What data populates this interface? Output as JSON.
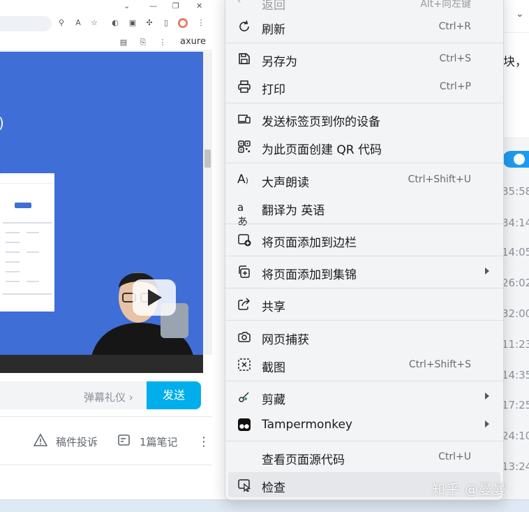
{
  "browser": {
    "profile_text": "axure",
    "danmaku_gift_label": "弹幕礼仪 ›",
    "send_label": "发送",
    "report_label": "稿件投诉",
    "notes_label": "1篇笔记"
  },
  "right_window": {
    "snippet": "块，",
    "times": [
      "35:58",
      "34:14",
      "14:05",
      "26:02",
      "32:00",
      "11:23",
      "14:35",
      "17:25",
      "24:10",
      "13:24"
    ]
  },
  "context_menu": {
    "back": {
      "label": "返回",
      "shortcut": "Alt+向左键"
    },
    "items": [
      {
        "label": "刷新",
        "shortcut": "Ctrl+R",
        "icon": "refresh-icon"
      },
      {
        "label": "另存为",
        "shortcut": "Ctrl+S",
        "icon": "save-as-icon"
      },
      {
        "label": "打印",
        "shortcut": "Ctrl+P",
        "icon": "print-icon"
      },
      {
        "label": "发送标签页到你的设备",
        "shortcut": "",
        "icon": "send-to-device-icon"
      },
      {
        "label": "为此页面创建 QR 代码",
        "shortcut": "",
        "icon": "qr-code-icon"
      },
      {
        "label": "大声朗读",
        "shortcut": "Ctrl+Shift+U",
        "icon": "read-aloud-icon"
      },
      {
        "label": "翻译为 英语",
        "shortcut": "",
        "icon": "translate-icon"
      },
      {
        "label": "将页面添加到边栏",
        "shortcut": "",
        "icon": "add-to-sidebar-icon"
      },
      {
        "label": "将页面添加到集锦",
        "shortcut": "",
        "icon": "add-to-collections-icon"
      },
      {
        "label": "共享",
        "shortcut": "",
        "icon": "share-icon"
      },
      {
        "label": "网页捕获",
        "shortcut": "",
        "icon": "web-capture-icon"
      },
      {
        "label": "截图",
        "shortcut": "Ctrl+Shift+S",
        "icon": "screenshot-icon"
      },
      {
        "label": "剪藏",
        "shortcut": "",
        "icon": "clip-icon"
      },
      {
        "label": "Tampermonkey",
        "shortcut": "",
        "icon": "tampermonkey-icon"
      },
      {
        "label": "查看页面源代码",
        "shortcut": "Ctrl+U",
        "icon": ""
      },
      {
        "label": "检查",
        "shortcut": "",
        "icon": "inspect-icon"
      }
    ]
  },
  "watermark": "知乎 @曼曼",
  "colors": {
    "video_bg": "#3f6ed6",
    "send_button": "#00aeec",
    "toggle": "#1e9bf0",
    "menu_bg": "#f3f4f6"
  }
}
